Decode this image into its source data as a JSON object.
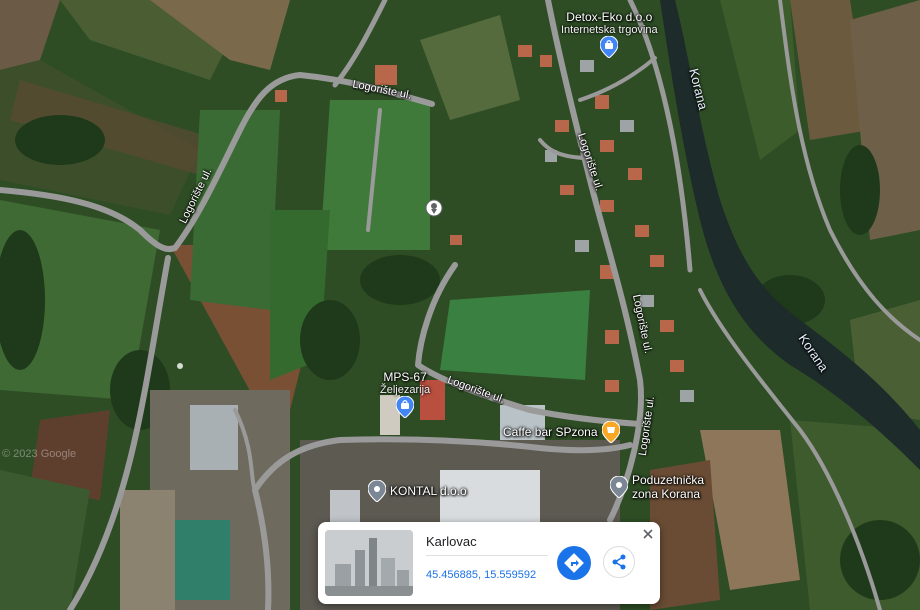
{
  "map": {
    "road_labels": [
      "Logorište ul.",
      "Logorište ul.",
      "Logorište ul.",
      "Logorište ul.",
      "Logorište ul."
    ],
    "river_labels": [
      "Korana",
      "Korana"
    ],
    "watermark": "© 2023 Google",
    "dropped_pin_icon": "location-pin-icon",
    "pois": [
      {
        "name": "Detox-Eko d.o.o",
        "subtitle": "Internetska trgovina",
        "icon": "shopping-bag-icon",
        "color": "#4285f4"
      },
      {
        "name": "MPS-67",
        "subtitle": "Željezarija",
        "icon": "shopping-bag-icon",
        "color": "#4285f4"
      },
      {
        "name": "Caffe bar SPzona",
        "subtitle": "",
        "icon": "cup-icon",
        "color": "#f9a825"
      },
      {
        "name": "KONTAL d.o.o",
        "subtitle": "",
        "icon": "location-pin-icon",
        "color": "#7b8794"
      },
      {
        "name": "Poduzetnička zona Korana",
        "subtitle": "",
        "icon": "location-pin-icon",
        "color": "#7b8794"
      }
    ]
  },
  "info_card": {
    "place": "Karlovac",
    "coordinates": "45.456885, 15.559592",
    "directions_icon": "directions-icon",
    "share_icon": "share-icon",
    "close_icon": "close-icon"
  }
}
